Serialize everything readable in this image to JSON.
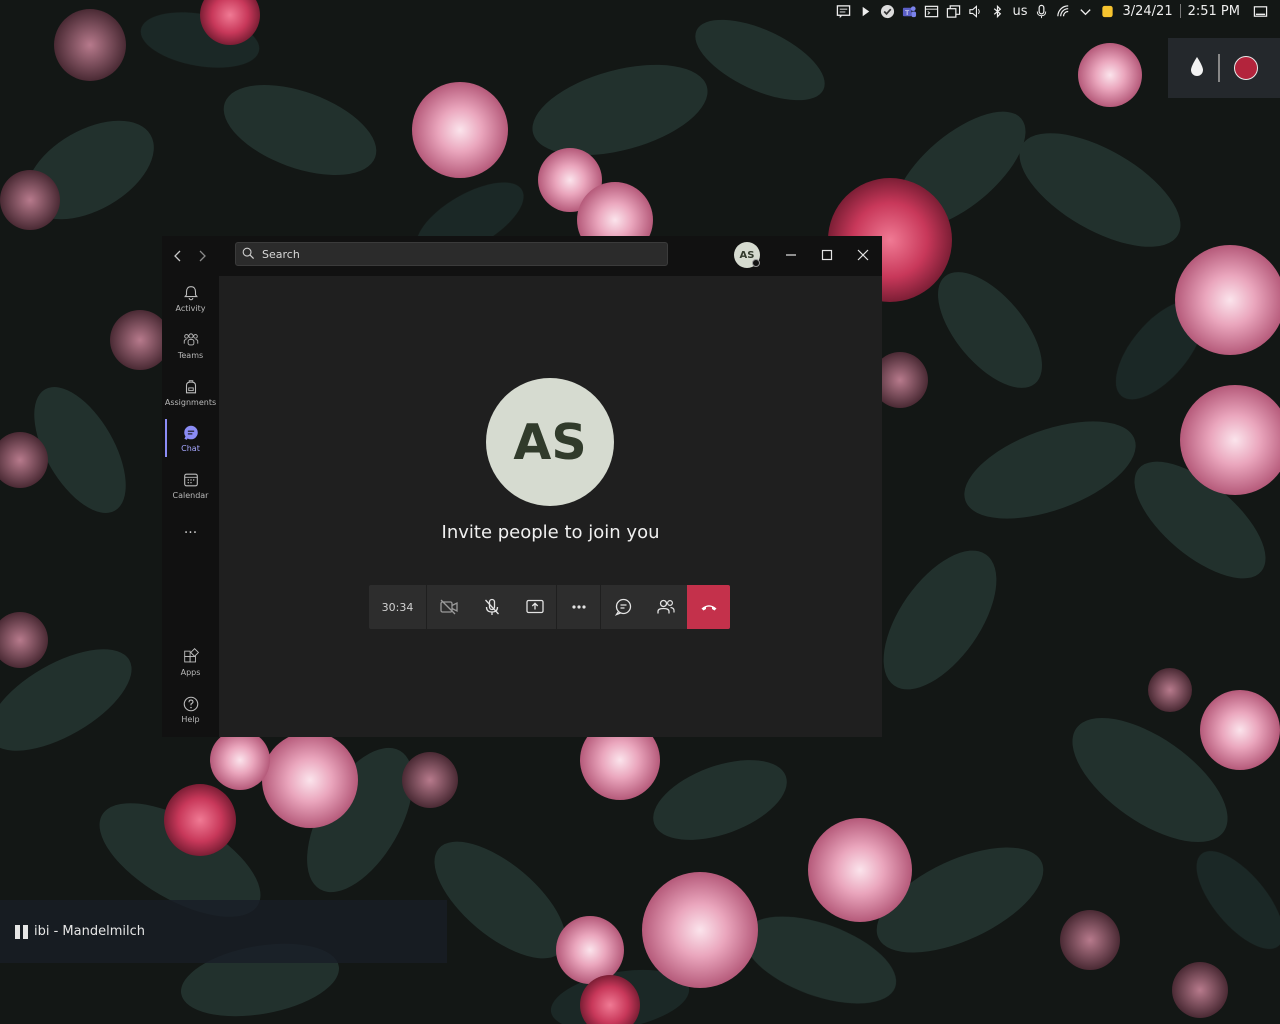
{
  "tray": {
    "keyboard_layout": "us",
    "date": "3/24/21",
    "time": "2:51 PM",
    "icons": [
      "chat-bubble-icon",
      "play-icon",
      "check-circle-icon",
      "teams-icon",
      "terminal-icon",
      "windows-icon",
      "volume-icon",
      "bluetooth-icon",
      "microphone-icon",
      "wifi-icon",
      "chevron-down-icon",
      "notes-icon",
      "desktop-icon"
    ]
  },
  "corner_widget": {
    "icons": [
      "droplet-icon",
      "record-icon"
    ],
    "record_color": "#b3243c"
  },
  "teams": {
    "search_placeholder": "Search",
    "user_initials": "AS",
    "rail": {
      "items": [
        {
          "label": "Activity",
          "icon": "bell-icon"
        },
        {
          "label": "Teams",
          "icon": "teams-people-icon"
        },
        {
          "label": "Assignments",
          "icon": "backpack-icon"
        },
        {
          "label": "Chat",
          "icon": "chat-icon",
          "active": true
        },
        {
          "label": "Calendar",
          "icon": "calendar-icon"
        },
        {
          "label": "Apps",
          "icon": "apps-icon"
        },
        {
          "label": "Help",
          "icon": "help-icon"
        }
      ],
      "more": "..."
    },
    "call": {
      "participant_initials": "AS",
      "invite_text": "Invite people to join you",
      "timer": "30:34",
      "controls": [
        "camera-off-icon",
        "mic-off-icon",
        "share-screen-icon",
        "more-icon",
        "chat-icon",
        "participants-icon",
        "hang-up-icon"
      ]
    },
    "accent_color": "#8b8cf5",
    "hangup_color": "#c4314b"
  },
  "media": {
    "title": "ibi - Mandelmilch",
    "state_icon": "pause-icon"
  }
}
